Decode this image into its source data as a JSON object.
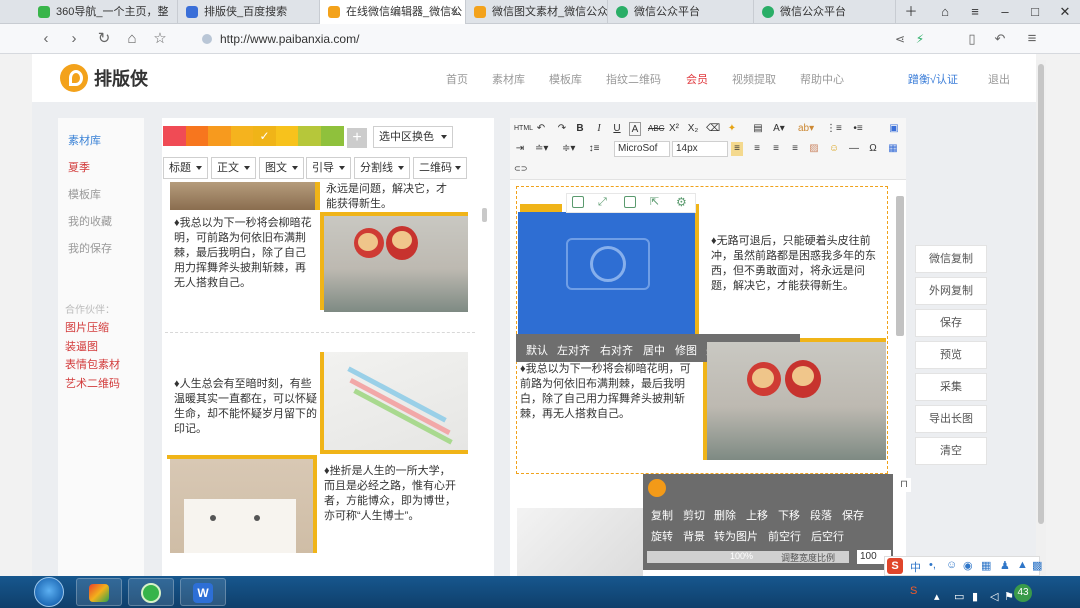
{
  "browser": {
    "tabs": [
      {
        "label": "360导航_一个主页，整"
      },
      {
        "label": "排版侠_百度搜索"
      },
      {
        "label": "在线微信编辑器_微信公",
        "active": true
      },
      {
        "label": "微信图文素材_微信公众"
      },
      {
        "label": "微信公众平台"
      },
      {
        "label": "微信公众平台"
      }
    ],
    "url": "http://www.paibanxia.com/"
  },
  "site": {
    "logo_text": "排版侠",
    "menu": [
      "首页",
      "素材库",
      "模板库",
      "指纹二维码",
      "会员",
      "视频提取",
      "帮助中心"
    ],
    "login": "蹭衡√认证",
    "logout": "退出"
  },
  "left_nav": {
    "items": [
      "素材库",
      "夏季",
      "模板库",
      "我的收藏",
      "我的保存"
    ],
    "partner_label": "合作伙伴：",
    "partners": [
      "图片压缩",
      "装逼图",
      "表情包素材",
      "艺术二维码"
    ]
  },
  "material": {
    "colors": [
      "#f04b55",
      "#f7761e",
      "#f79a1e",
      "#f5b31e",
      "#f0b418",
      "#f7c21c",
      "#b6c73a",
      "#8fc13c"
    ],
    "checked_index": 4,
    "color_select": "选中区换色",
    "categories": [
      "标题",
      "正文",
      "图文",
      "引导",
      "分割线",
      "二维码"
    ],
    "card1_top": "永远是问题，解决它，才能获得新生。",
    "card1_text": "♦我总以为下一秒将会柳暗花明，可前路为何依旧布满荆棘，最后我明白，除了自己用力挥舞斧头披荆斩棘，再无人搭救自己。",
    "card2_text": "♦人生总会有至暗时刻，有些温暖其实一直都在，可以怀疑生命，却不能怀疑岁月留下的印记。",
    "card3_text": "♦挫折是人生的一所大学，而且是必经之路，惟有心开者，方能博众，即为博世，亦可称“人生博士”。"
  },
  "editor": {
    "font": "MicrosoftYaHei",
    "font_display": "MicroSof",
    "size": "14px",
    "doc_text1": "♦无路可退后，只能硬着头皮往前冲，虽然前路都是困惑我多年的东西，但不勇敢面对，将永远是问题，解决它，才能获得新生。",
    "doc_text2": "♦我总以为下一秒将会柳暗花明，可前路为何依旧布满荆棘，最后我明白，除了自己用力挥舞斧头披荆斩棘，再无人搭救自己。",
    "image_ctx": [
      "默认",
      "左对齐",
      "右对齐",
      "居中",
      "修图",
      "美图",
      "拼图",
      "换图"
    ]
  },
  "actions": [
    "微信复制",
    "外网复制",
    "保存",
    "预览",
    "采集",
    "导出长图",
    "清空"
  ],
  "popup": {
    "row1": [
      "复制",
      "剪切",
      "删除",
      "上移",
      "下移",
      "段落",
      "保存"
    ],
    "row2": [
      "旋转",
      "背景",
      "转为图片",
      "前空行",
      "后空行"
    ],
    "width_percent": "100%",
    "width_label": "调整宽度比例",
    "width_value": "100",
    "fill_fraction": 1.0
  },
  "tray": {
    "ime_label": "中",
    "badge": "43"
  }
}
